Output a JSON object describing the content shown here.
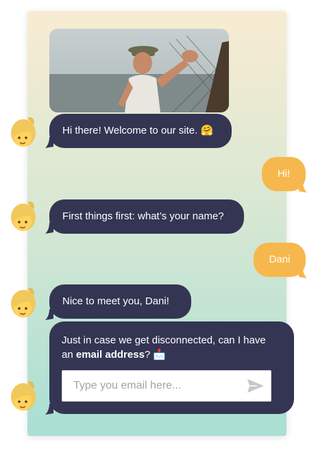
{
  "messages": {
    "m1": "Hi there! Welcome to our site. 🤗",
    "m2": "Hi!",
    "m3": "First things first: what’s your name?",
    "m4": "Dani",
    "m5": "Nice to meet you, Dani!",
    "m6_line1": "Just in case we get disconnected, can I have",
    "m6_line2_prefix": "an ",
    "m6_line2_bold": "email address",
    "m6_line2_suffix": "? 📩"
  },
  "email_input": {
    "placeholder": "Type you email here..."
  },
  "colors": {
    "bot_bubble": "#343553",
    "user_bubble": "#f6b84c"
  },
  "icons": {
    "send": "send-icon",
    "avatar": "avatar-icon"
  }
}
